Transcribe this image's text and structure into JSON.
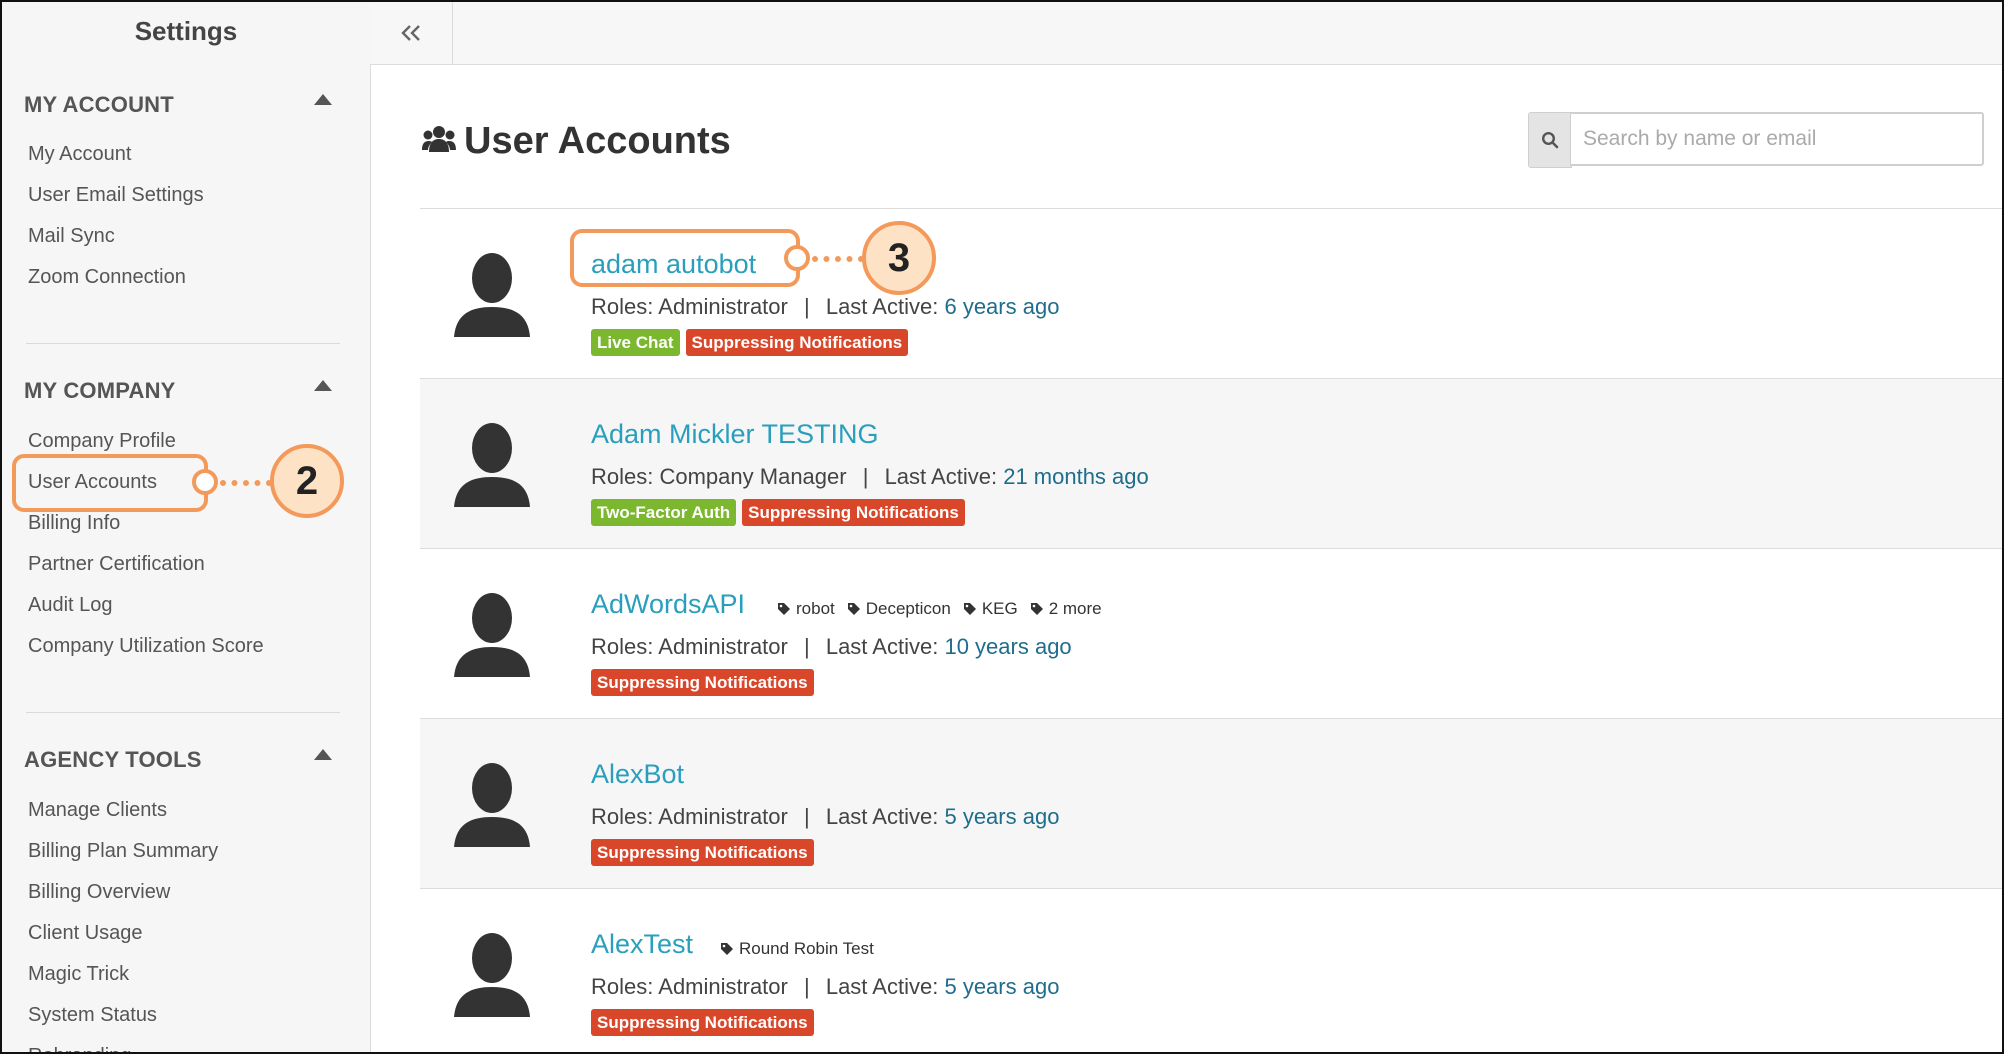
{
  "sidebar": {
    "title": "Settings",
    "sections": [
      {
        "heading": "MY ACCOUNT",
        "items": [
          "My Account",
          "User Email Settings",
          "Mail Sync",
          "Zoom Connection"
        ]
      },
      {
        "heading": "MY COMPANY",
        "items": [
          "Company Profile",
          "User Accounts",
          "Billing Info",
          "Partner Certification",
          "Audit Log",
          "Company Utilization Score"
        ]
      },
      {
        "heading": "AGENCY TOOLS",
        "items": [
          "Manage Clients",
          "Billing Plan Summary",
          "Billing Overview",
          "Client Usage",
          "Magic Trick",
          "System Status",
          "Rebranding"
        ]
      }
    ]
  },
  "topbar": {
    "collapse_icon": "double-chevron-left-icon"
  },
  "main": {
    "title": "User Accounts",
    "title_icon": "users-icon",
    "search": {
      "placeholder": "Search by name or email",
      "value": "",
      "icon": "search-icon"
    }
  },
  "labels": {
    "roles": "Roles:",
    "last_active": "Last Active:",
    "separator": "|"
  },
  "users": [
    {
      "name": "adam autobot",
      "role": "Administrator",
      "last_active": "6 years ago",
      "tags": [],
      "badges": [
        {
          "label": "Live Chat",
          "color": "#7cb82f"
        },
        {
          "label": "Suppressing Notifications",
          "color": "#d9472b"
        }
      ]
    },
    {
      "name": "Adam Mickler TESTING",
      "role": "Company Manager",
      "last_active": "21 months ago",
      "tags": [],
      "badges": [
        {
          "label": "Two-Factor Auth",
          "color": "#7cb82f"
        },
        {
          "label": "Suppressing Notifications",
          "color": "#d9472b"
        }
      ]
    },
    {
      "name": "AdWordsAPI",
      "role": "Administrator",
      "last_active": "10 years ago",
      "tags": [
        "robot",
        "Decepticon",
        "KEG",
        "2 more"
      ],
      "badges": [
        {
          "label": "Suppressing Notifications",
          "color": "#d9472b"
        }
      ]
    },
    {
      "name": "AlexBot",
      "role": "Administrator",
      "last_active": "5 years ago",
      "tags": [],
      "badges": [
        {
          "label": "Suppressing Notifications",
          "color": "#d9472b"
        }
      ]
    },
    {
      "name": "AlexTest",
      "role": "Administrator",
      "last_active": "5 years ago",
      "tags": [
        "Round Robin Test"
      ],
      "badges": [
        {
          "label": "Suppressing Notifications",
          "color": "#d9472b"
        }
      ]
    }
  ],
  "callouts": [
    {
      "number": "2"
    },
    {
      "number": "3"
    }
  ],
  "colors": {
    "accent_link": "#2a9fbc",
    "callout": "#f39a5b",
    "green_badge": "#7cb82f",
    "red_badge": "#d9472b"
  }
}
